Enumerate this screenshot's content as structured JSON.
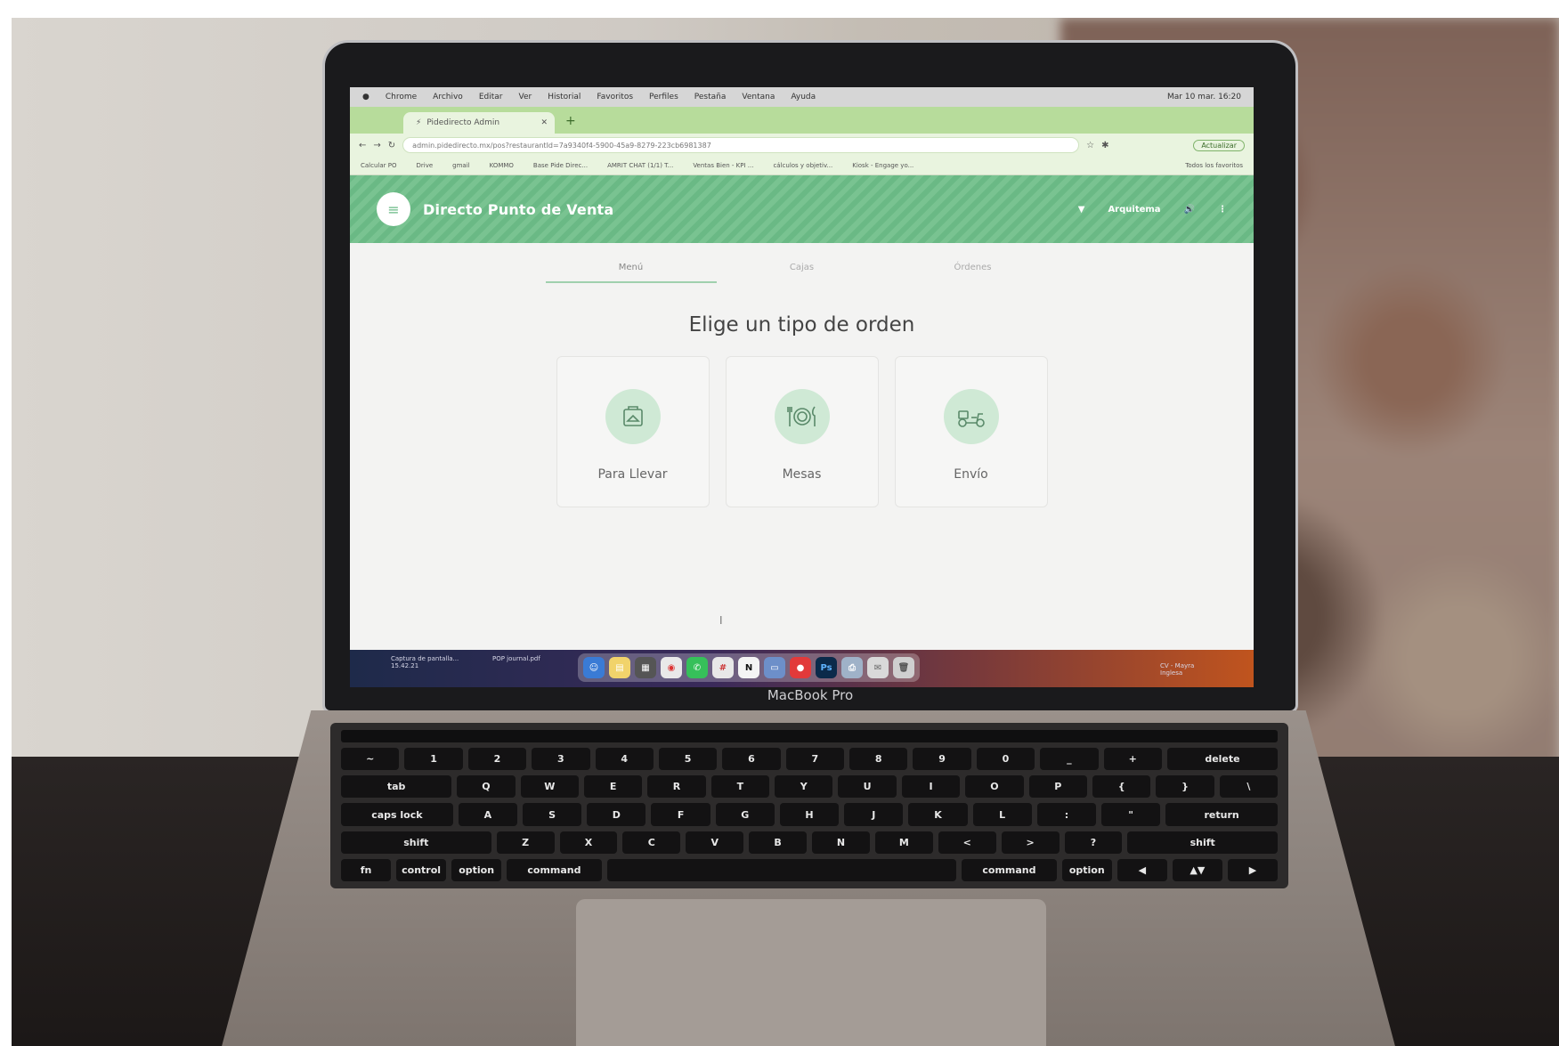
{
  "menubar": {
    "items": [
      "Chrome",
      "Archivo",
      "Editar",
      "Ver",
      "Historial",
      "Favoritos",
      "Perfiles",
      "Pestaña",
      "Ventana",
      "Ayuda"
    ],
    "clock": "Mar 10 mar. 16:20"
  },
  "browser": {
    "tab_title": "Pidedirecto Admin",
    "url": "admin.pidedirecto.mx/pos?restaurantId=7a9340f4-5900-45a9-8279-223cb6981387",
    "update_label": "Actualizar",
    "bookmarks": [
      "Calcular PO",
      "Drive",
      "gmail",
      "KOMMO",
      "Base Pide Direc...",
      "AMRIT CHAT (1/1) T...",
      "Ventas Bien - KPI ...",
      "cálculos y objetiv...",
      "Kiosk - Engage yo..."
    ],
    "bookmarks_all": "Todos los favoritos"
  },
  "app": {
    "title": "Directo Punto de Venta",
    "user": "Arquitema",
    "tabs": [
      "Menú",
      "Cajas",
      "Órdenes"
    ],
    "heading": "Elige un tipo de orden",
    "order_types": [
      {
        "label": "Para Llevar",
        "icon": "takeaway-bag-icon"
      },
      {
        "label": "Mesas",
        "icon": "plate-cutlery-icon"
      },
      {
        "label": "Envío",
        "icon": "scooter-delivery-icon"
      }
    ]
  },
  "desktop": {
    "note_left": "Captura de pantalla... 15.42.21",
    "note_left2": "POP journal.pdf",
    "note_right": "CV - Mayra Inglesa"
  },
  "device": {
    "brand": "MacBook Pro"
  },
  "keyboard": {
    "row1": [
      "~",
      "1",
      "2",
      "3",
      "4",
      "5",
      "6",
      "7",
      "8",
      "9",
      "0",
      "_",
      "+",
      "delete"
    ],
    "row2": [
      "tab",
      "Q",
      "W",
      "E",
      "R",
      "T",
      "Y",
      "U",
      "I",
      "O",
      "P",
      "{",
      "}",
      "\\"
    ],
    "row3": [
      "caps lock",
      "A",
      "S",
      "D",
      "F",
      "G",
      "H",
      "J",
      "K",
      "L",
      ":",
      "\"",
      "return"
    ],
    "row4": [
      "shift",
      "Z",
      "X",
      "C",
      "V",
      "B",
      "N",
      "M",
      "<",
      ">",
      "?",
      "shift"
    ],
    "row5": [
      "fn",
      "control",
      "option",
      "command",
      "",
      "command",
      "option",
      "◀",
      "▲▼",
      "▶"
    ]
  },
  "colors": {
    "header_green": "#6ab985",
    "tab_strip_green": "#b7dc9b",
    "icon_circle": "#cfe9d5"
  }
}
